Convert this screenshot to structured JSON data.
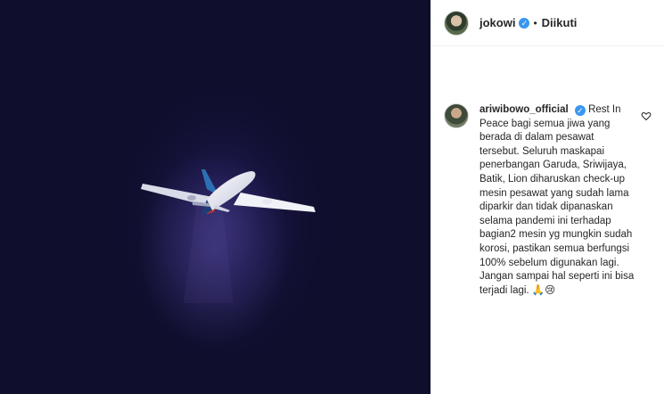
{
  "header": {
    "username": "jokowi",
    "separator": "•",
    "follow_label": "Diikuti"
  },
  "comment": {
    "username": "ariwibowo_official",
    "text": "Rest In Peace bagi semua jiwa yang berada di dalam pesawat tersebut. Seluruh maskapai penerbangan Garuda, Sriwijaya, Batik, Lion diharuskan check-up mesin pesawat yang sudah lama diparkir dan tidak dipanaskan selama pandemi ini terhadap bagian2 mesin yg mungkin sudah korosi, pastikan semua berfungsi 100% sebelum digunakan lagi. Jangan sampai hal seperti ini bisa terjadi lagi.",
    "emoji": "🙏😢"
  },
  "icons": {
    "verified": "verified-badge-icon",
    "heart": "heart-outline-icon"
  },
  "colors": {
    "media_background": "#0f0e2c",
    "verified_blue": "#3897f0",
    "text": "#262626"
  }
}
